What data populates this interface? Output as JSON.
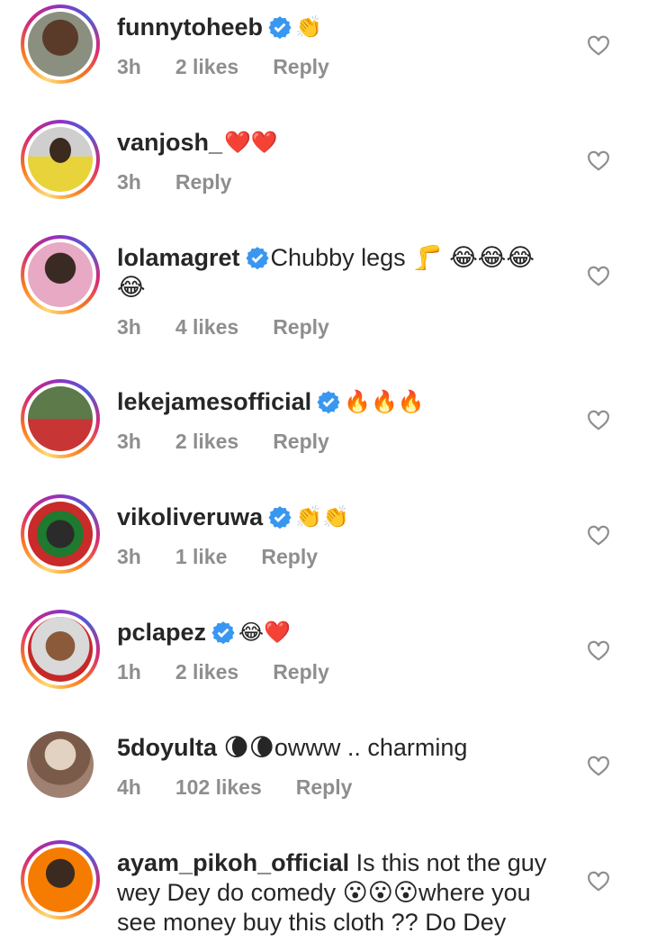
{
  "comments": [
    {
      "username": "funnytoheeb",
      "verified": true,
      "text": "👏",
      "time": "3h",
      "likes": "2 likes",
      "reply": "Reply"
    },
    {
      "username": "vanjosh_",
      "verified": false,
      "text": "❤️❤️",
      "time": "3h",
      "likes": "",
      "reply": "Reply"
    },
    {
      "username": "lolamagret",
      "verified": true,
      "text": "Chubby legs 🦵 😂😂😂😂",
      "time": "3h",
      "likes": "4 likes",
      "reply": "Reply"
    },
    {
      "username": "lekejamesofficial",
      "verified": true,
      "text": "🔥🔥🔥",
      "time": "3h",
      "likes": "2 likes",
      "reply": "Reply"
    },
    {
      "username": "vikoliveruwa",
      "verified": true,
      "text": "👏👏",
      "time": "3h",
      "likes": "1 like",
      "reply": "Reply"
    },
    {
      "username": "pclapez",
      "verified": true,
      "text": "😂❤️",
      "time": "1h",
      "likes": "2 likes",
      "reply": "Reply"
    },
    {
      "username": "5doyulta",
      "verified": false,
      "text": "🌘🌘owww .. charming",
      "time": "4h",
      "likes": "102 likes",
      "reply": "Reply"
    },
    {
      "username": "ayam_pikoh_official",
      "verified": false,
      "text": "Is this not the guy wey Dey do comedy 😮😮😮where you see money buy this cloth ?? Do Dey",
      "time": "",
      "likes": "",
      "reply": ""
    }
  ],
  "colors": {
    "verified": "#3897f0",
    "meta": "#8e8e8e",
    "text": "#262626"
  }
}
